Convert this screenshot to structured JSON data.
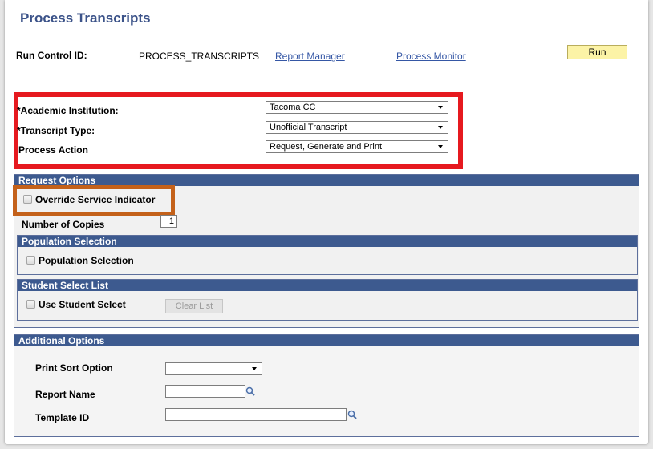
{
  "page": {
    "title": "Process Transcripts"
  },
  "run_control": {
    "label": "Run Control ID:",
    "value": "PROCESS_TRANSCRIPTS",
    "report_manager": "Report Manager",
    "process_monitor": "Process Monitor",
    "run_label": "Run"
  },
  "main_fields": {
    "institution": {
      "label": "*Academic Institution:",
      "value": "Tacoma CC"
    },
    "transcript_type": {
      "label": "*Transcript Type:",
      "value": "Unofficial Transcript"
    },
    "process_action": {
      "label": "Process Action",
      "value": "Request, Generate and Print"
    }
  },
  "request_options": {
    "header": "Request Options",
    "override_label": "Override Service Indicator",
    "copies_label": "Number of Copies",
    "copies_value": "1"
  },
  "population": {
    "header": "Population Selection",
    "checkbox_label": "Population Selection"
  },
  "student_select": {
    "header": "Student Select List",
    "checkbox_label": "Use Student Select",
    "clear_label": "Clear List"
  },
  "additional": {
    "header": "Additional Options",
    "sort_label": "Print Sort Option",
    "sort_value": "",
    "report_label": "Report Name",
    "report_value": "",
    "template_label": "Template ID",
    "template_value": ""
  },
  "colors": {
    "title": "#3c5389",
    "header_bar": "#3d5a8f",
    "highlight_red": "#e6191f",
    "highlight_orange": "#c4611a",
    "run_button": "#fcf3a6",
    "link": "#3557a5"
  },
  "icons": [
    "dropdown-arrow-icon",
    "lookup-magnifier-icon",
    "checkbox-icon"
  ]
}
